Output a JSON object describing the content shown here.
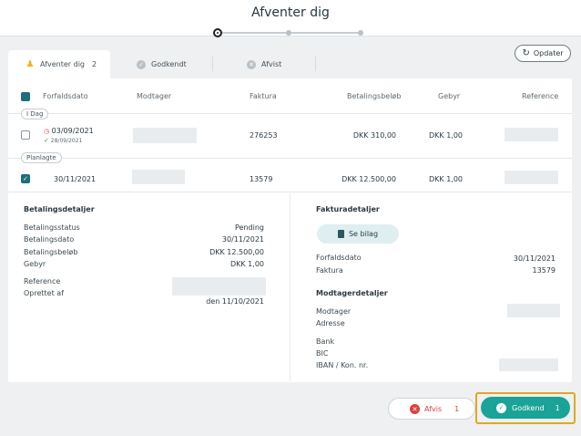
{
  "header": {
    "title": "Afventer dig"
  },
  "tabs": [
    {
      "label": "Afventer dig",
      "count": "2",
      "icon": "user-icon",
      "color": "#f2b01e"
    },
    {
      "label": "Godkendt",
      "icon": "check-circle-icon",
      "color": "#b9c1c6"
    },
    {
      "label": "Afvist",
      "icon": "x-circle-icon",
      "color": "#b9c1c6"
    }
  ],
  "toolbar": {
    "refresh_label": "Opdater"
  },
  "table": {
    "columns": [
      "Forfaldsdato",
      "Modtager",
      "Faktura",
      "Betalingsbeløb",
      "Gebyr",
      "Reference"
    ],
    "groups": [
      {
        "label": "I Dag",
        "rows": [
          {
            "due_date": "03/09/2021",
            "sub_date": "28/09/2021",
            "invoice": "276253",
            "amount": "DKK 310,00",
            "fee": "DKK 1,00"
          }
        ]
      },
      {
        "label": "Planlagte",
        "rows": [
          {
            "due_date": "30/11/2021",
            "invoice": "13579",
            "amount": "DKK 12.500,00",
            "fee": "DKK 1,00"
          }
        ]
      }
    ]
  },
  "details": {
    "payment": {
      "title": "Betalingsdetaljer",
      "status_label": "Betalingsstatus",
      "status_value": "Pending",
      "date_label": "Betalingsdato",
      "date_value": "30/11/2021",
      "amount_label": "Betalingsbeløb",
      "amount_value": "DKK 12.500,00",
      "fee_label": "Gebyr",
      "fee_value": "DKK 1,00",
      "reference_label": "Reference",
      "created_label": "Oprettet af",
      "created_date": "den 11/10/2021"
    },
    "invoice": {
      "title": "Fakturadetaljer",
      "attachment_label": "Se bilag",
      "due_label": "Forfaldsdato",
      "due_value": "30/11/2021",
      "invoice_label": "Faktura",
      "invoice_value": "13579"
    },
    "recipient": {
      "title": "Modtagerdetaljer",
      "recipient_label": "Modtager",
      "address_label": "Adresse",
      "bank_label": "Bank",
      "bic_label": "BIC",
      "iban_label": "IBAN / Kon. nr."
    }
  },
  "actions": {
    "reject_label": "Afvis",
    "reject_count": "1",
    "approve_label": "Godkend",
    "approve_count": "1"
  },
  "colors": {
    "accent": "#1aa396",
    "reject": "#d9423e",
    "highlight": "#e0a821"
  }
}
